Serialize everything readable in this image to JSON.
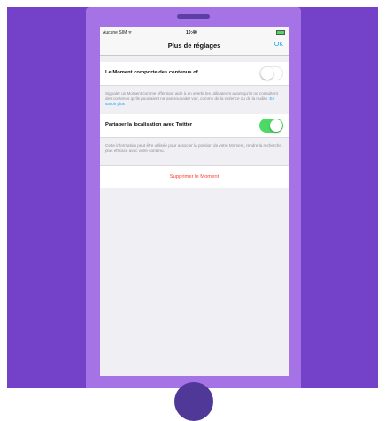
{
  "status_bar": {
    "carrier": "Aucune SIM ᯤ",
    "time": "10:40",
    "battery": "▬+"
  },
  "nav": {
    "title": "Plus de réglages",
    "ok_label": "OK"
  },
  "sensitive": {
    "label": "Le Moment comporte des contenus of…",
    "toggle_on": false,
    "description": "Signaler un Moment comme offensant aide à en avertir les utilisateurs avant qu'ils ne consultent des contenus qu'ils pourraient ne pas souhaiter voir, comme de la violence ou de la nudité. ",
    "link_label": "En savoir plus"
  },
  "location": {
    "label": "Partager la localisation avec Twitter",
    "toggle_on": true,
    "description": "Cette information peut être utilisée pour associer la position de votre Moment, rendre la recherche plus efficace avec votre contenu."
  },
  "delete": {
    "label": "Supprimer le Moment"
  },
  "colors": {
    "background": "#7442c8",
    "phone": "#a573e6",
    "accent": "#1da1f2",
    "toggle_on": "#4cd964",
    "destructive": "#ff3b30"
  }
}
